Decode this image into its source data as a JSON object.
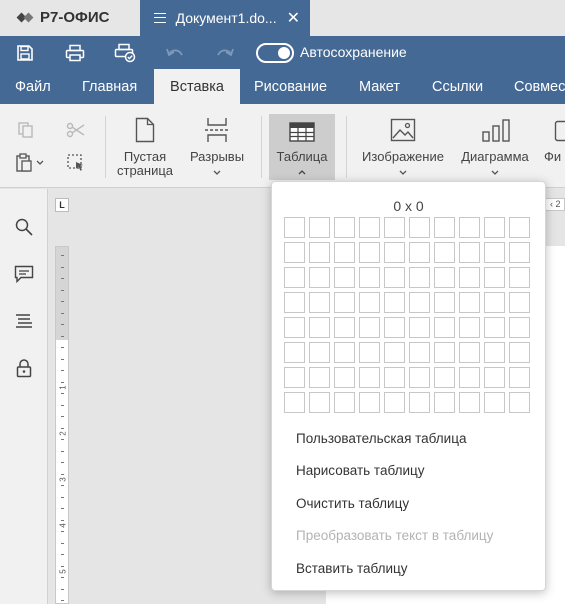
{
  "app": {
    "logo_text": "Р7-ОФИС"
  },
  "document_tab": {
    "title": "Документ1.do...",
    "close_symbol": "✕"
  },
  "quick_access": {
    "autosave_label": "Автосохранение",
    "autosave_on": true
  },
  "menu_tabs": [
    {
      "label": "Файл"
    },
    {
      "label": "Главная"
    },
    {
      "label": "Вставка",
      "active": true
    },
    {
      "label": "Рисование"
    },
    {
      "label": "Макет"
    },
    {
      "label": "Ссылки"
    },
    {
      "label": "Совмес"
    }
  ],
  "ribbon": {
    "blank_page": {
      "line1": "Пустая",
      "line2": "страница"
    },
    "breaks": {
      "label": "Разрывы"
    },
    "table": {
      "label": "Таблица"
    },
    "image": {
      "label": "Изображение"
    },
    "chart": {
      "label": "Диаграмма"
    },
    "cut_next": {
      "label": "Фи"
    }
  },
  "ruler": {
    "numbers": [
      "1",
      "2",
      "3",
      "4",
      "5"
    ],
    "top_marker": "L",
    "h_number": "2"
  },
  "table_dropdown": {
    "dimension_label": "0 x 0",
    "grid_rows": 8,
    "grid_cols": 10,
    "items": [
      {
        "label": "Пользовательская таблица",
        "disabled": false
      },
      {
        "label": "Нарисовать таблицу",
        "disabled": false
      },
      {
        "label": "Очистить таблицу",
        "disabled": false
      },
      {
        "label": "Преобразовать текст в таблицу",
        "disabled": true
      },
      {
        "label": "Вставить таблицу",
        "disabled": false
      }
    ]
  },
  "colors": {
    "accent": "#446995",
    "ribbon_bg": "#f1f1f1",
    "active_button": "#cdcdcd"
  }
}
